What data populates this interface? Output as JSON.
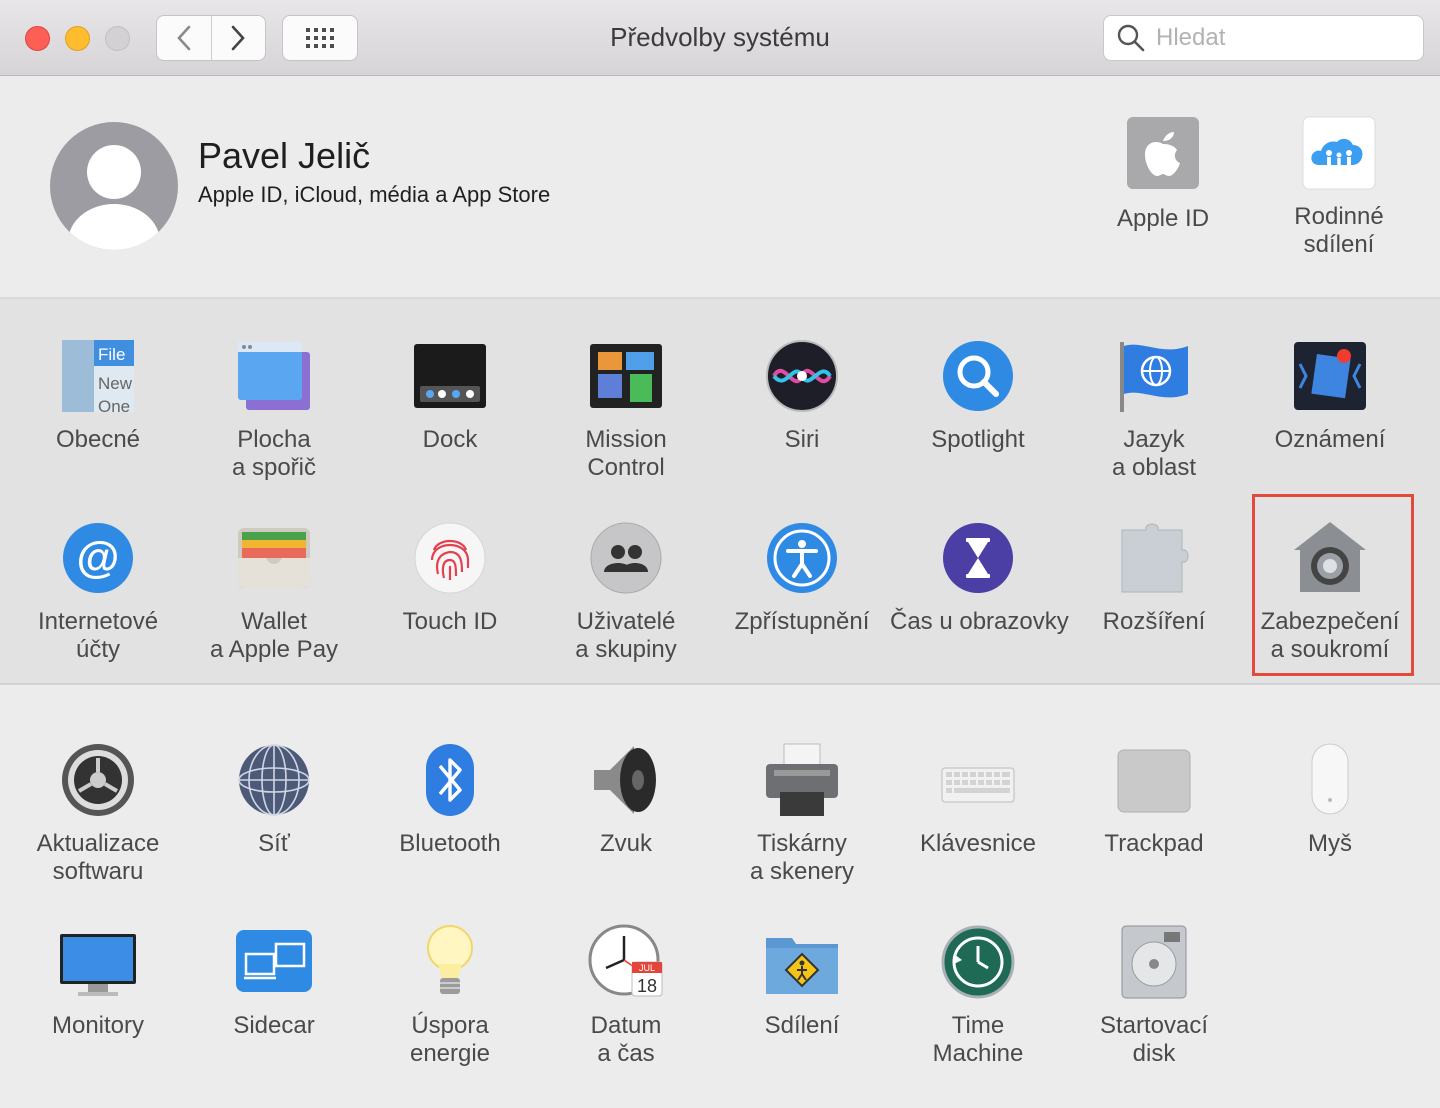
{
  "window": {
    "title": "Předvolby systému"
  },
  "search": {
    "placeholder": "Hledat"
  },
  "profile": {
    "name": "Pavel Jelič",
    "subtitle": "Apple ID, iCloud, média a App Store",
    "items": [
      {
        "label1": "Apple ID",
        "label2": ""
      },
      {
        "label1": "Rodinné",
        "label2": "sdílení"
      }
    ]
  },
  "panes_row1": [
    {
      "label1": "Obecné",
      "label2": "",
      "icon": "general-icon"
    },
    {
      "label1": "Plocha",
      "label2": "a spořič",
      "icon": "desktop-icon"
    },
    {
      "label1": "Dock",
      "label2": "",
      "icon": "dock-icon"
    },
    {
      "label1": "Mission",
      "label2": "Control",
      "icon": "mission-control-icon"
    },
    {
      "label1": "Siri",
      "label2": "",
      "icon": "siri-icon"
    },
    {
      "label1": "Spotlight",
      "label2": "",
      "icon": "spotlight-icon"
    },
    {
      "label1": "Jazyk",
      "label2": "a oblast",
      "icon": "language-icon"
    },
    {
      "label1": "Oznámení",
      "label2": "",
      "icon": "notifications-icon"
    }
  ],
  "panes_row2": [
    {
      "label1": "Internetové",
      "label2": "účty",
      "icon": "internet-accounts-icon"
    },
    {
      "label1": "Wallet",
      "label2": "a Apple Pay",
      "icon": "wallet-icon"
    },
    {
      "label1": "Touch ID",
      "label2": "",
      "icon": "fingerprint-icon"
    },
    {
      "label1": "Uživatelé",
      "label2": "a skupiny",
      "icon": "users-icon"
    },
    {
      "label1": "Zpřístupnění",
      "label2": "",
      "icon": "accessibility-icon"
    },
    {
      "label1": "Čas u obrazovky",
      "label2": "",
      "icon": "screen-time-icon"
    },
    {
      "label1": "Rozšíření",
      "label2": "",
      "icon": "extensions-icon"
    },
    {
      "label1": "Zabezpečení",
      "label2": "a soukromí",
      "icon": "security-icon"
    }
  ],
  "panes_row3": [
    {
      "label1": "Aktualizace",
      "label2": "softwaru",
      "icon": "software-update-icon"
    },
    {
      "label1": "Síť",
      "label2": "",
      "icon": "network-icon"
    },
    {
      "label1": "Bluetooth",
      "label2": "",
      "icon": "bluetooth-icon"
    },
    {
      "label1": "Zvuk",
      "label2": "",
      "icon": "sound-icon"
    },
    {
      "label1": "Tiskárny",
      "label2": "a skenery",
      "icon": "printer-icon"
    },
    {
      "label1": "Klávesnice",
      "label2": "",
      "icon": "keyboard-icon"
    },
    {
      "label1": "Trackpad",
      "label2": "",
      "icon": "trackpad-icon"
    },
    {
      "label1": "Myš",
      "label2": "",
      "icon": "mouse-icon"
    }
  ],
  "panes_row4": [
    {
      "label1": "Monitory",
      "label2": "",
      "icon": "display-icon"
    },
    {
      "label1": "Sidecar",
      "label2": "",
      "icon": "sidecar-icon"
    },
    {
      "label1": "Úspora",
      "label2": "energie",
      "icon": "energy-icon"
    },
    {
      "label1": "Datum",
      "label2": "a čas",
      "icon": "clock-icon"
    },
    {
      "label1": "Sdílení",
      "label2": "",
      "icon": "sharing-icon"
    },
    {
      "label1": "Time",
      "label2": "Machine",
      "icon": "time-machine-icon"
    },
    {
      "label1": "Startovací",
      "label2": "disk",
      "icon": "startup-disk-icon"
    }
  ],
  "icon_text": {
    "general": [
      "File",
      "New",
      "One"
    ],
    "calendar_month": "JUL",
    "calendar_day": "18"
  },
  "colors": {
    "highlight": "#e24b3c",
    "accent": "#2f7de1"
  }
}
